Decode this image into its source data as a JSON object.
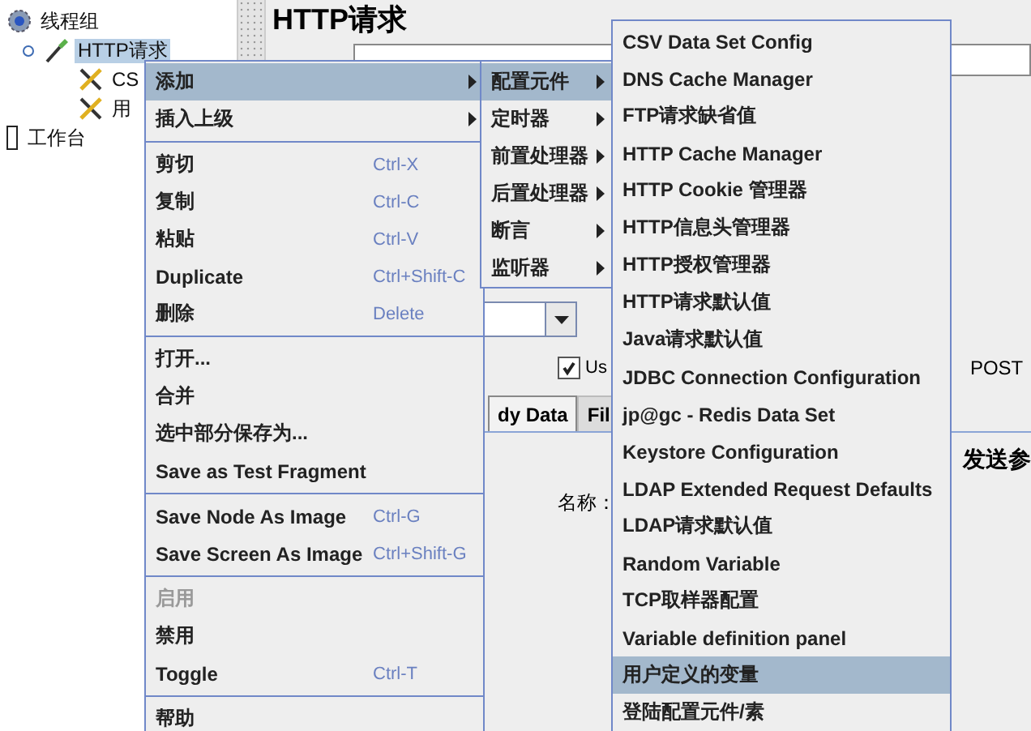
{
  "tree": [
    {
      "label": "线程组",
      "kind": "thread_group",
      "selected": false,
      "children": [
        {
          "label": "HTTP请求",
          "kind": "sampler",
          "selected": true,
          "children": [
            {
              "label": "CS",
              "kind": "config",
              "selected": false
            },
            {
              "label": "用",
              "kind": "config",
              "selected": false
            }
          ]
        }
      ]
    },
    {
      "label": "工作台",
      "kind": "workbench",
      "selected": false
    }
  ],
  "editor": {
    "title": "HTTP请求",
    "use_checkbox": {
      "label": "Us",
      "checked": true
    },
    "post_text": "POST",
    "tabs": [
      {
        "label": "dy Data",
        "selected": true
      },
      {
        "label": "Fil",
        "selected": false
      }
    ],
    "params_text": "发送参",
    "name_label_2": "名称："
  },
  "context_menu": {
    "items": [
      {
        "kind": "item",
        "label": "添加",
        "submenu": true,
        "selected": true,
        "disabled": false
      },
      {
        "kind": "item",
        "label": "插入上级",
        "submenu": true,
        "selected": false,
        "disabled": false
      },
      {
        "kind": "separator"
      },
      {
        "kind": "item",
        "label": "剪切",
        "shortcut": "Ctrl-X",
        "selected": false,
        "disabled": false
      },
      {
        "kind": "item",
        "label": "复制",
        "shortcut": "Ctrl-C",
        "selected": false,
        "disabled": false
      },
      {
        "kind": "item",
        "label": "粘贴",
        "shortcut": "Ctrl-V",
        "selected": false,
        "disabled": false
      },
      {
        "kind": "item",
        "label": "Duplicate",
        "shortcut": "Ctrl+Shift-C",
        "selected": false,
        "disabled": false
      },
      {
        "kind": "item",
        "label": "删除",
        "shortcut": "Delete",
        "selected": false,
        "disabled": false
      },
      {
        "kind": "separator"
      },
      {
        "kind": "item",
        "label": "打开...",
        "selected": false,
        "disabled": false
      },
      {
        "kind": "item",
        "label": "合并",
        "selected": false,
        "disabled": false
      },
      {
        "kind": "item",
        "label": "选中部分保存为...",
        "selected": false,
        "disabled": false
      },
      {
        "kind": "item",
        "label": "Save as Test Fragment",
        "selected": false,
        "disabled": false
      },
      {
        "kind": "separator"
      },
      {
        "kind": "item",
        "label": "Save Node As Image",
        "shortcut": "Ctrl-G",
        "selected": false,
        "disabled": false
      },
      {
        "kind": "item",
        "label": "Save Screen As Image",
        "shortcut": "Ctrl+Shift-G",
        "selected": false,
        "disabled": false
      },
      {
        "kind": "separator"
      },
      {
        "kind": "item",
        "label": "启用",
        "selected": false,
        "disabled": true
      },
      {
        "kind": "item",
        "label": "禁用",
        "selected": false,
        "disabled": false
      },
      {
        "kind": "item",
        "label": "Toggle",
        "shortcut": "Ctrl-T",
        "selected": false,
        "disabled": false
      },
      {
        "kind": "separator"
      },
      {
        "kind": "item",
        "label": "帮助",
        "selected": false,
        "disabled": false
      }
    ]
  },
  "add_submenu": {
    "items": [
      {
        "kind": "item",
        "label": "配置元件",
        "submenu": true,
        "selected": true,
        "disabled": false
      },
      {
        "kind": "item",
        "label": "定时器",
        "submenu": true,
        "selected": false,
        "disabled": false
      },
      {
        "kind": "item",
        "label": "前置处理器",
        "submenu": true,
        "selected": false,
        "disabled": false
      },
      {
        "kind": "item",
        "label": "后置处理器",
        "submenu": true,
        "selected": false,
        "disabled": false
      },
      {
        "kind": "item",
        "label": "断言",
        "submenu": true,
        "selected": false,
        "disabled": false
      },
      {
        "kind": "item",
        "label": "监听器",
        "submenu": true,
        "selected": false,
        "disabled": false
      }
    ]
  },
  "config_submenu": {
    "items": [
      {
        "kind": "item",
        "label": "CSV Data Set Config",
        "selected": false,
        "disabled": false
      },
      {
        "kind": "item",
        "label": "DNS Cache Manager",
        "selected": false,
        "disabled": false
      },
      {
        "kind": "item",
        "label": "FTP请求缺省值",
        "selected": false,
        "disabled": false
      },
      {
        "kind": "item",
        "label": "HTTP Cache Manager",
        "selected": false,
        "disabled": false
      },
      {
        "kind": "item",
        "label": "HTTP Cookie 管理器",
        "selected": false,
        "disabled": false
      },
      {
        "kind": "item",
        "label": "HTTP信息头管理器",
        "selected": false,
        "disabled": false
      },
      {
        "kind": "item",
        "label": "HTTP授权管理器",
        "selected": false,
        "disabled": false
      },
      {
        "kind": "item",
        "label": "HTTP请求默认值",
        "selected": false,
        "disabled": false
      },
      {
        "kind": "item",
        "label": "Java请求默认值",
        "selected": false,
        "disabled": false
      },
      {
        "kind": "item",
        "label": "JDBC Connection Configuration",
        "selected": false,
        "disabled": false
      },
      {
        "kind": "item",
        "label": "jp@gc - Redis Data Set",
        "selected": false,
        "disabled": false
      },
      {
        "kind": "item",
        "label": "Keystore Configuration",
        "selected": false,
        "disabled": false
      },
      {
        "kind": "item",
        "label": "LDAP Extended Request Defaults",
        "selected": false,
        "disabled": false
      },
      {
        "kind": "item",
        "label": "LDAP请求默认值",
        "selected": false,
        "disabled": false
      },
      {
        "kind": "item",
        "label": "Random Variable",
        "selected": false,
        "disabled": false
      },
      {
        "kind": "item",
        "label": "TCP取样器配置",
        "selected": false,
        "disabled": false
      },
      {
        "kind": "item",
        "label": "Variable definition panel",
        "selected": false,
        "disabled": false
      },
      {
        "kind": "item",
        "label": "用户定义的变量",
        "selected": true,
        "disabled": false
      },
      {
        "kind": "item",
        "label": "登陆配置元件/素",
        "selected": false,
        "disabled": false
      }
    ]
  }
}
